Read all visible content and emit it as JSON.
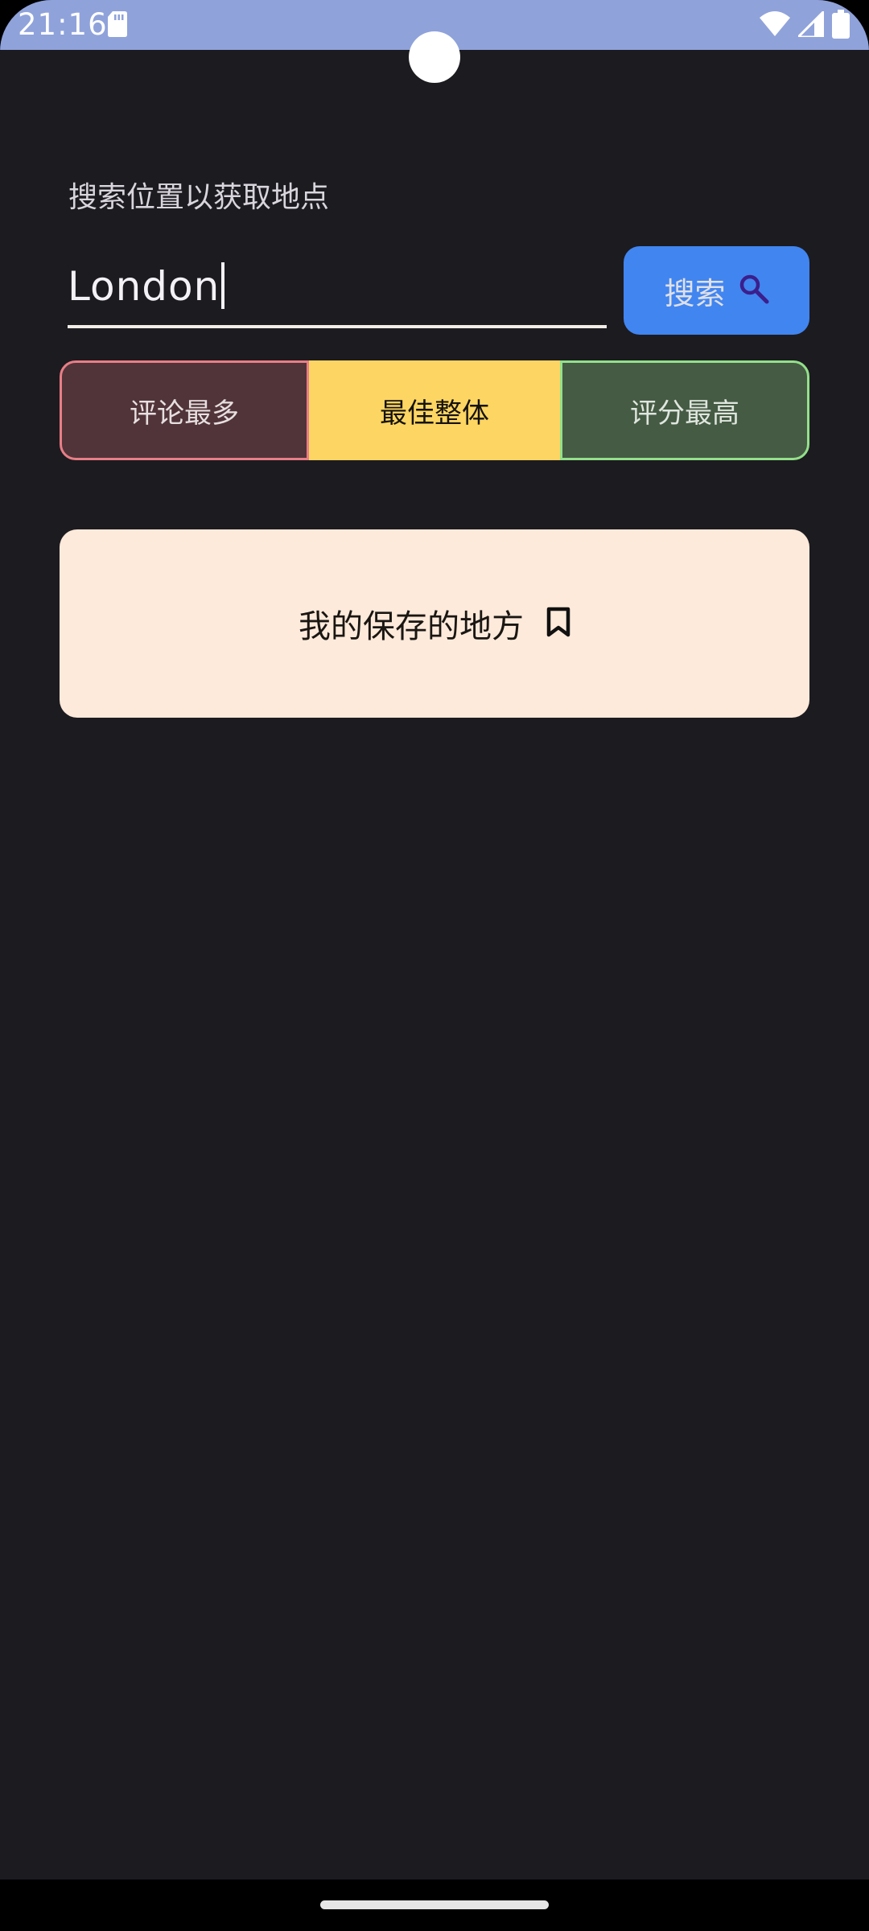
{
  "status_bar": {
    "time": "21:16",
    "icons": [
      "sd-card-icon",
      "wifi-icon",
      "signal-icon",
      "battery-icon"
    ]
  },
  "search": {
    "label": "搜索位置以获取地点",
    "value": "London",
    "button_label": "搜索",
    "button_icon": "search-icon"
  },
  "filters": {
    "options": [
      {
        "label": "评论最多",
        "color": "#51343a",
        "border": "#e87e86"
      },
      {
        "label": "最佳整体",
        "color": "#fdd563",
        "selected": true
      },
      {
        "label": "评分最高",
        "color": "#455b44",
        "border": "#93e08a"
      }
    ]
  },
  "saved_places": {
    "label": "我的保存的地方",
    "icon": "bookmark-icon",
    "color": "#fdeadb"
  },
  "colors": {
    "background": "#1c1b20",
    "status_bar": "#8fa2da",
    "accent": "#4185f0"
  }
}
